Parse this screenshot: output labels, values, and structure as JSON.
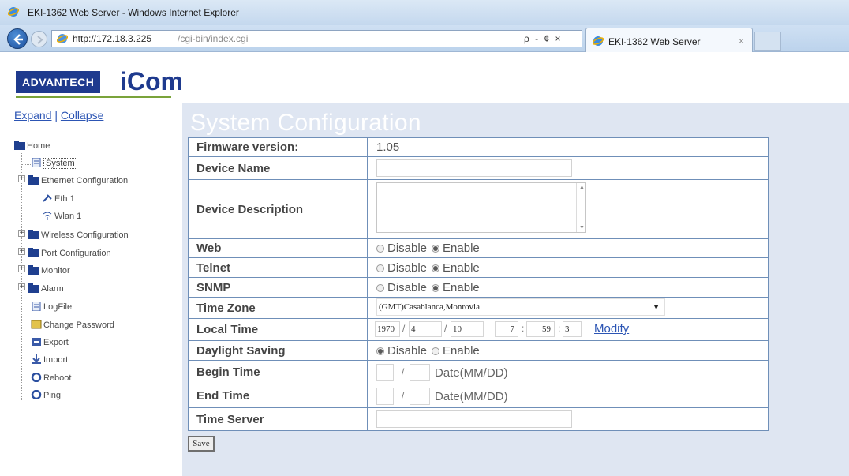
{
  "browser": {
    "window_title": "EKI-1362 Web Server - Windows Internet Explorer",
    "address_host": "http://172.18.3.225",
    "address_path": "/cgi-bin/index.cgi",
    "address_actions": "ρ - ¢ ×",
    "tab_label": "EKI-1362 Web Server",
    "tab_close": "×"
  },
  "header": {
    "brand": "ADVANTECH",
    "product": "iCom"
  },
  "sidebar": {
    "expand": "Expand",
    "separator": "|",
    "collapse": "Collapse",
    "items": {
      "home": "Home",
      "system": "System",
      "ethernet": "Ethernet Configuration",
      "eth1": "Eth 1",
      "wlan1": "Wlan 1",
      "wireless": "Wireless Configuration",
      "port": "Port Configuration",
      "monitor": "Monitor",
      "alarm": "Alarm",
      "logfile": "LogFile",
      "change_password": "Change Password",
      "export": "Export",
      "import": "Import",
      "reboot": "Reboot",
      "ping": "Ping"
    }
  },
  "main": {
    "title": "System Configuration",
    "labels": {
      "firmware": "Firmware version:",
      "device_name": "Device Name",
      "device_description": "Device Description",
      "web": "Web",
      "telnet": "Telnet",
      "snmp": "SNMP",
      "time_zone": "Time Zone",
      "local_time": "Local Time",
      "daylight": "Daylight Saving",
      "begin_time": "Begin Time",
      "end_time": "End Time",
      "time_server": "Time Server"
    },
    "firmware_version": "1.05",
    "options": {
      "disable": "Disable",
      "enable": "Enable"
    },
    "time_zone_value": "(GMT)Casablanca,Monrovia",
    "local_time": {
      "year": "1970",
      "month": "4",
      "day": "10",
      "hour": "7",
      "minute": "59",
      "second": "3",
      "sep_slash": "/",
      "sep_colon": ":"
    },
    "modify_link": "Modify",
    "date_sep": "/",
    "date_hint": "Date(MM/DD)",
    "save_label": "Save"
  }
}
